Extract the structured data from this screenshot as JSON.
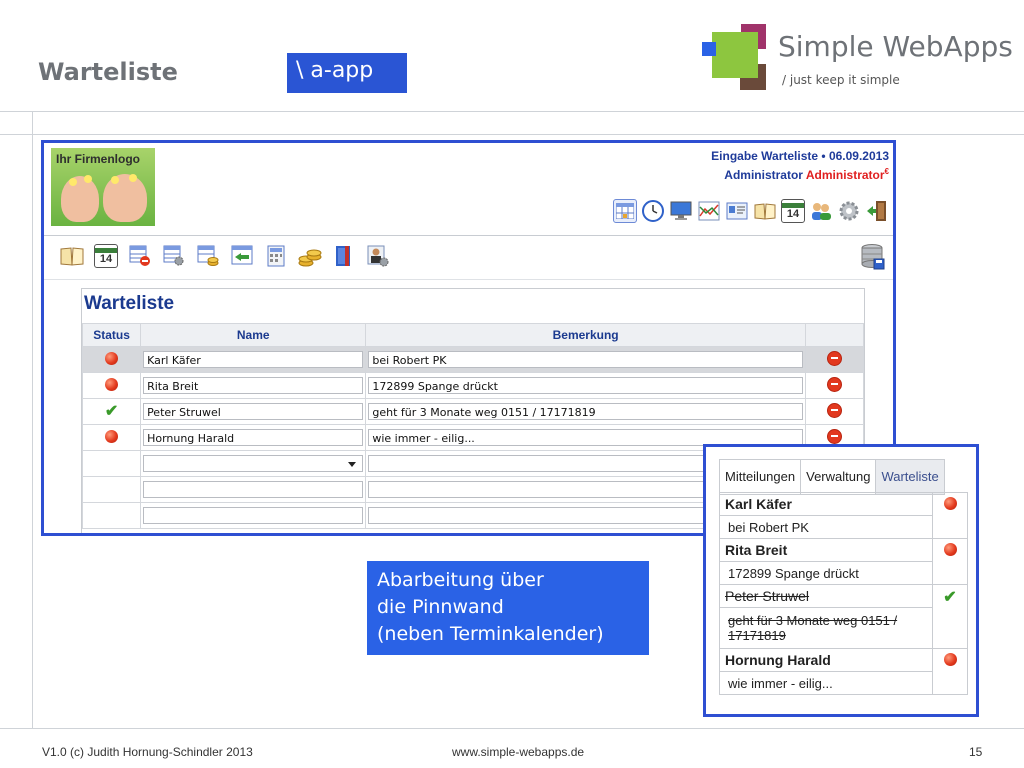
{
  "slide": {
    "title": "Warteliste",
    "badge": "\\ a-app",
    "brand": {
      "name": "Simple WebApps",
      "tagline": "/ just keep it simple"
    }
  },
  "app": {
    "logo_text": "Ihr Firmenlogo",
    "input_title": "Eingabe Warteliste • 06.09.2013",
    "user_label": "Administrator",
    "user_role": "Administrator",
    "user_badge": "€",
    "calendar_day": "14",
    "toolbar_icons": [
      "spreadsheet-icon",
      "clock-icon",
      "monitor-icon",
      "chart-icon",
      "id-card-icon",
      "book-icon",
      "calendar-icon",
      "users-icon",
      "gear-icon",
      "exit-door-icon"
    ],
    "secondary_icons": [
      "book-icon",
      "calendar-icon",
      "table-delete-icon",
      "table-settings-icon",
      "table-coins-icon",
      "table-arrow-icon",
      "calculator-icon",
      "coins-icon",
      "binder-icon",
      "user-settings-icon"
    ]
  },
  "waitlist": {
    "title": "Warteliste",
    "columns": {
      "status": "Status",
      "name": "Name",
      "remark": "Bemerkung"
    },
    "rows": [
      {
        "status": "open",
        "name": "Karl Käfer",
        "remark": "bei Robert PK"
      },
      {
        "status": "open",
        "name": "Rita Breit",
        "remark": "172899 Spange drückt"
      },
      {
        "status": "done",
        "name": "Peter Struwel",
        "remark": "geht für 3 Monate weg 0151 / 17171819"
      },
      {
        "status": "open",
        "name": "Hornung Harald",
        "remark": "wie immer - eilig..."
      }
    ]
  },
  "callout": {
    "line1": "Abarbeitung über",
    "line2": "die Pinnwand",
    "line3": "(neben Terminkalender)"
  },
  "pinboard": {
    "tabs": [
      "Mitteilungen",
      "Verwaltung",
      "Warteliste"
    ],
    "active_tab": "Warteliste",
    "entries": [
      {
        "name": "Karl Käfer",
        "note": "bei Robert PK",
        "status": "open"
      },
      {
        "name": "Rita Breit",
        "note": "172899 Spange drückt",
        "status": "open"
      },
      {
        "name": "Peter Struwel",
        "note": "geht für 3 Monate weg 0151 / 17171819",
        "status": "done"
      },
      {
        "name": "Hornung Harald",
        "note": "wie immer - eilig...",
        "status": "open"
      }
    ]
  },
  "footer": {
    "left": "V1.0  (c) Judith Hornung-Schindler 2013",
    "url": "www.simple-webapps.de",
    "page": "15"
  },
  "colors": {
    "accent_blue": "#2e4fd2",
    "header_blue": "#1b3a8f",
    "alert_red": "#e02020",
    "ok_green": "#3a9a2a"
  }
}
